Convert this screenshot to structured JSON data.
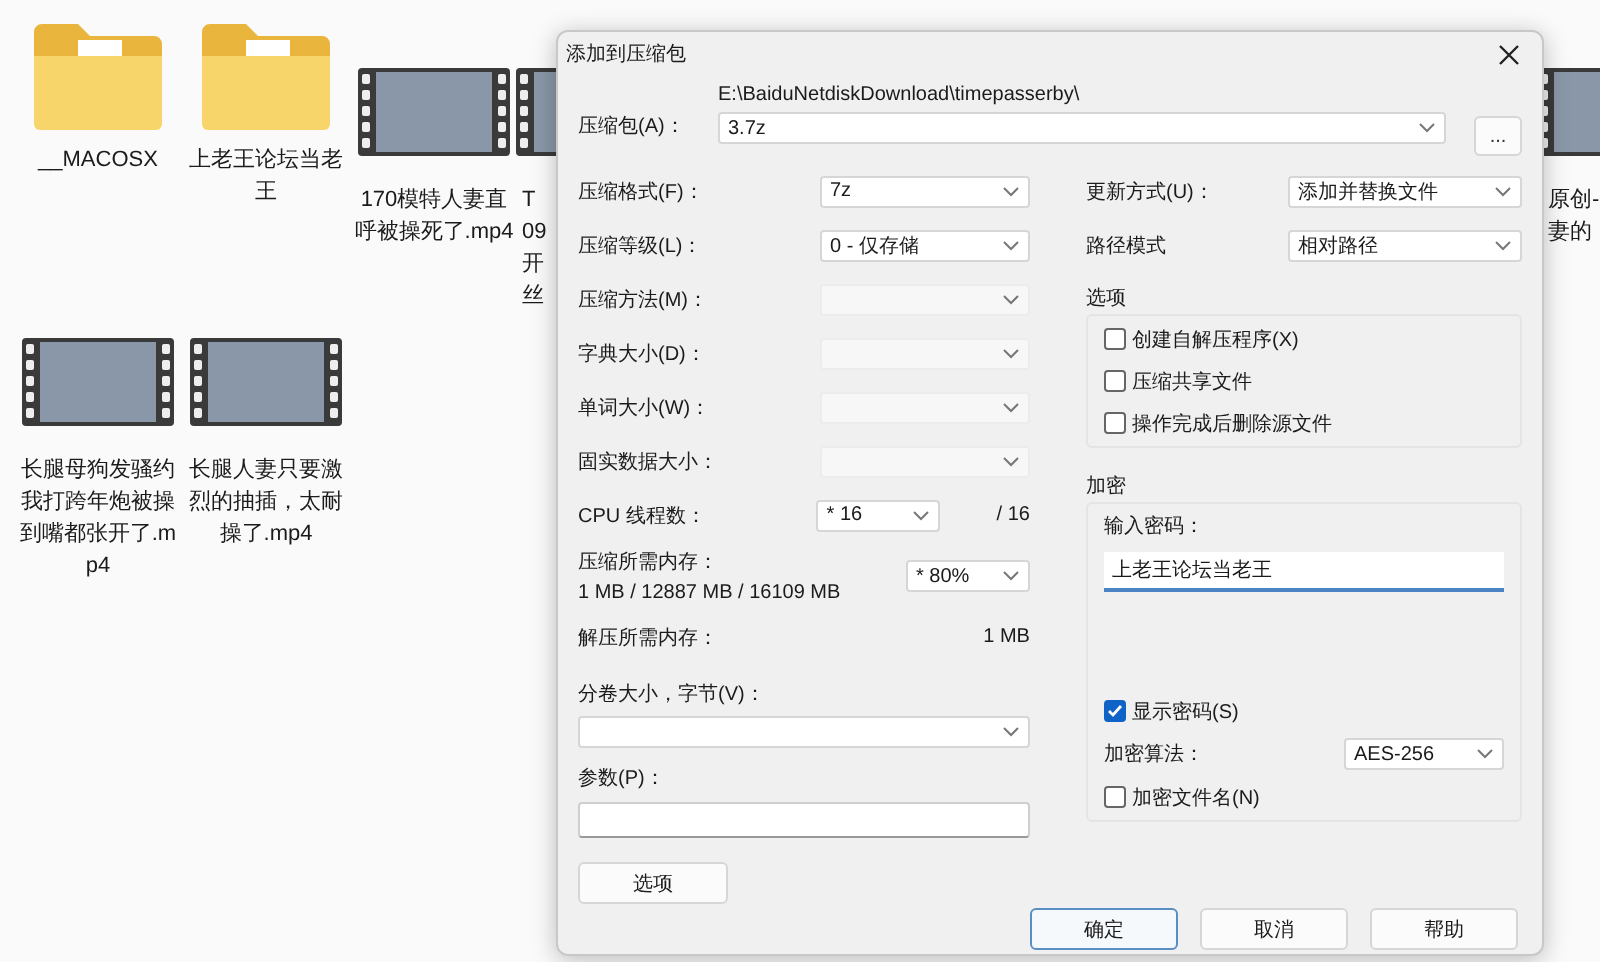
{
  "desktop_icons": [
    {
      "kind": "folder",
      "label": "__MACOSX"
    },
    {
      "kind": "folder",
      "label": "上老王论坛当老王"
    },
    {
      "kind": "video",
      "label": "170模特人妻直呼被操死了.mp4"
    },
    {
      "kind": "video_cut_right",
      "lines": [
        "T",
        "09",
        "开",
        "丝"
      ]
    },
    {
      "kind": "video",
      "label": "长腿母狗发骚约我打跨年炮被操到嘴都张开了.mp4"
    },
    {
      "kind": "video",
      "label": "长腿人妻只要激烈的抽插，太耐操了.mp4"
    },
    {
      "kind": "video_cut_left",
      "lines": [
        "原创-",
        "妻的"
      ]
    }
  ],
  "dialog": {
    "title": "添加到压缩包",
    "archive": {
      "label": "压缩包(A)：",
      "path": "E:\\BaiduNetdiskDownload\\timepasserby\\",
      "value": "3.7z",
      "browse": "..."
    },
    "left_rows": [
      {
        "kind": "combo",
        "label": "压缩格式(F)：",
        "value": "7z",
        "disabled": false
      },
      {
        "kind": "combo",
        "label": "压缩等级(L)：",
        "value": "0 - 仅存储",
        "disabled": false
      },
      {
        "kind": "combo",
        "label": "压缩方法(M)：",
        "disabled": true
      },
      {
        "kind": "combo",
        "label": "字典大小(D)：",
        "disabled": true
      },
      {
        "kind": "combo",
        "label": "单词大小(W)：",
        "disabled": true
      },
      {
        "kind": "combo",
        "label": "固实数据大小：",
        "disabled": true
      },
      {
        "kind": "threads",
        "label": "CPU 线程数：",
        "value": "* 16",
        "suffix": "/ 16",
        "disabled": false
      },
      {
        "kind": "memory",
        "label": "压缩所需内存：",
        "detail": "1 MB / 12887 MB / 16109 MB",
        "value": "* 80%",
        "disabled": false
      },
      {
        "kind": "info",
        "label": "解压所需内存：",
        "value": "1 MB"
      }
    ],
    "volume": {
      "label": "分卷大小，字节(V)："
    },
    "params": {
      "label": "参数(P)："
    },
    "options_button": "选项",
    "right_rows": [
      {
        "label": "更新方式(U)：",
        "value": "添加并替换文件"
      },
      {
        "label": "路径模式",
        "value": "相对路径"
      }
    ],
    "options_group": {
      "title": "选项",
      "checkboxes": [
        {
          "label": "创建自解压程序(X)",
          "checked": false
        },
        {
          "label": "压缩共享文件",
          "checked": false
        },
        {
          "label": "操作完成后删除源文件",
          "checked": false
        }
      ]
    },
    "encryption": {
      "title": "加密",
      "password_label": "输入密码：",
      "password": "上老王论坛当老王",
      "show_password": {
        "label": "显示密码(S)",
        "checked": true
      },
      "method_label": "加密算法：",
      "method": "AES-256",
      "encrypt_names": {
        "label": "加密文件名(N)",
        "checked": false
      }
    },
    "buttons": [
      {
        "label": "确定",
        "selected": true
      },
      {
        "label": "取消",
        "selected": false
      },
      {
        "label": "帮助",
        "selected": false
      }
    ]
  }
}
